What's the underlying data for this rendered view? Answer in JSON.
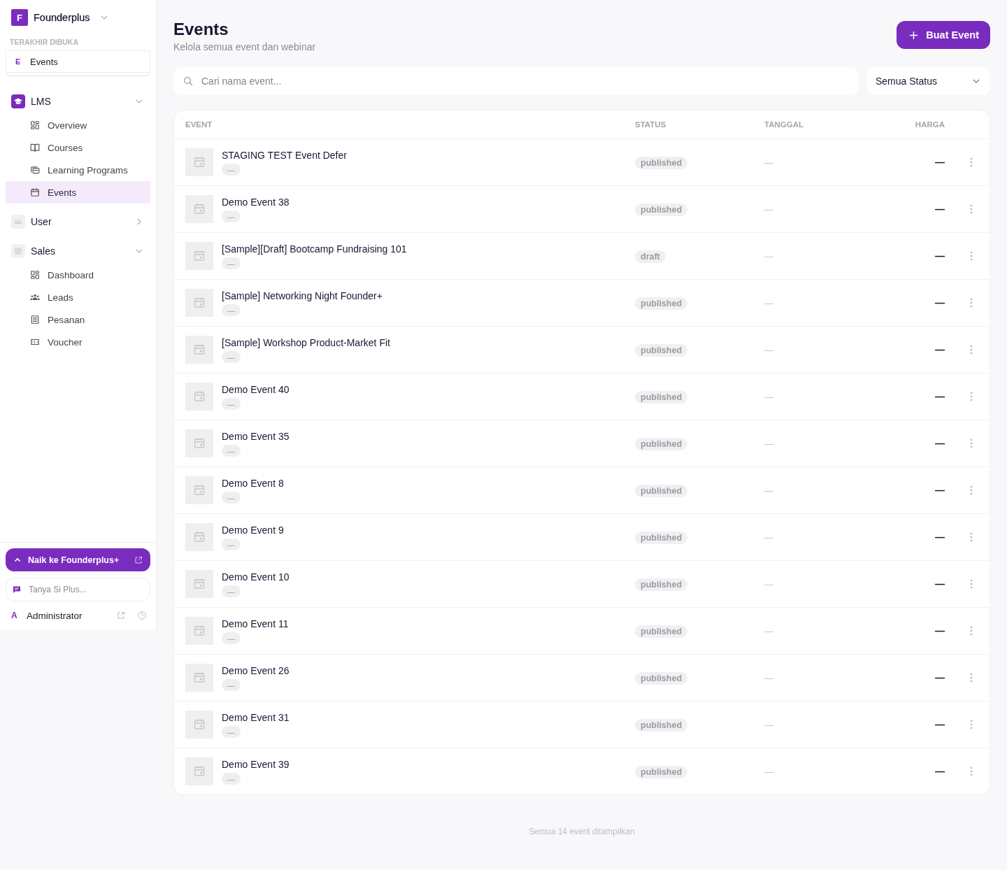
{
  "sidebar": {
    "workspace": {
      "initial": "F",
      "name": "Founderplus"
    },
    "recent": {
      "heading": "TERAKHIR DIBUKA",
      "items": [
        {
          "initial": "E",
          "label": "Events"
        }
      ]
    },
    "groups": [
      {
        "label": "LMS",
        "expanded": true,
        "items": [
          {
            "label": "Overview",
            "selected": false
          },
          {
            "label": "Courses",
            "selected": false
          },
          {
            "label": "Learning Programs",
            "selected": false
          },
          {
            "label": "Events",
            "selected": true
          }
        ]
      },
      {
        "label": "User",
        "expanded": false
      },
      {
        "label": "Sales",
        "expanded": true,
        "items": [
          {
            "label": "Dashboard",
            "selected": false
          },
          {
            "label": "Leads",
            "selected": false
          },
          {
            "label": "Pesanan",
            "selected": false
          },
          {
            "label": "Voucher",
            "selected": false
          }
        ]
      }
    ],
    "upgrade": {
      "label": "Naik ke Founderplus+"
    },
    "assistant": {
      "placeholder": "Tanya Si Plus..."
    },
    "account": {
      "initial": "A",
      "name": "Administrator"
    }
  },
  "header": {
    "title": "Events",
    "subtitle": "Kelola semua event dan webinar",
    "action": "Buat Event"
  },
  "search": {
    "placeholder": "Cari nama event..."
  },
  "status_filter": {
    "value": "Semua Status"
  },
  "table": {
    "columns": [
      "EVENT",
      "STATUS",
      "TANGGAL",
      "HARGA"
    ],
    "rows": [
      {
        "name": "STAGING TEST Event Defer",
        "tag": "—",
        "status": "published",
        "date": "—",
        "price": "—"
      },
      {
        "name": "Demo Event 38",
        "tag": "—",
        "status": "published",
        "date": "—",
        "price": "—"
      },
      {
        "name": "[Sample][Draft] Bootcamp Fundraising 101",
        "tag": "—",
        "status": "draft",
        "date": "—",
        "price": "—"
      },
      {
        "name": "[Sample] Networking Night Founder+",
        "tag": "—",
        "status": "published",
        "date": "—",
        "price": "—"
      },
      {
        "name": "[Sample] Workshop Product-Market Fit",
        "tag": "—",
        "status": "published",
        "date": "—",
        "price": "—"
      },
      {
        "name": "Demo Event 40",
        "tag": "—",
        "status": "published",
        "date": "—",
        "price": "—"
      },
      {
        "name": "Demo Event 35",
        "tag": "—",
        "status": "published",
        "date": "—",
        "price": "—"
      },
      {
        "name": "Demo Event 8",
        "tag": "—",
        "status": "published",
        "date": "—",
        "price": "—"
      },
      {
        "name": "Demo Event 9",
        "tag": "—",
        "status": "published",
        "date": "—",
        "price": "—"
      },
      {
        "name": "Demo Event 10",
        "tag": "—",
        "status": "published",
        "date": "—",
        "price": "—"
      },
      {
        "name": "Demo Event 11",
        "tag": "—",
        "status": "published",
        "date": "—",
        "price": "—"
      },
      {
        "name": "Demo Event 26",
        "tag": "—",
        "status": "published",
        "date": "—",
        "price": "—"
      },
      {
        "name": "Demo Event 31",
        "tag": "—",
        "status": "published",
        "date": "—",
        "price": "—"
      },
      {
        "name": "Demo Event 39",
        "tag": "—",
        "status": "published",
        "date": "—",
        "price": "—"
      }
    ]
  },
  "footer": "Semua 14 event ditampilkan"
}
